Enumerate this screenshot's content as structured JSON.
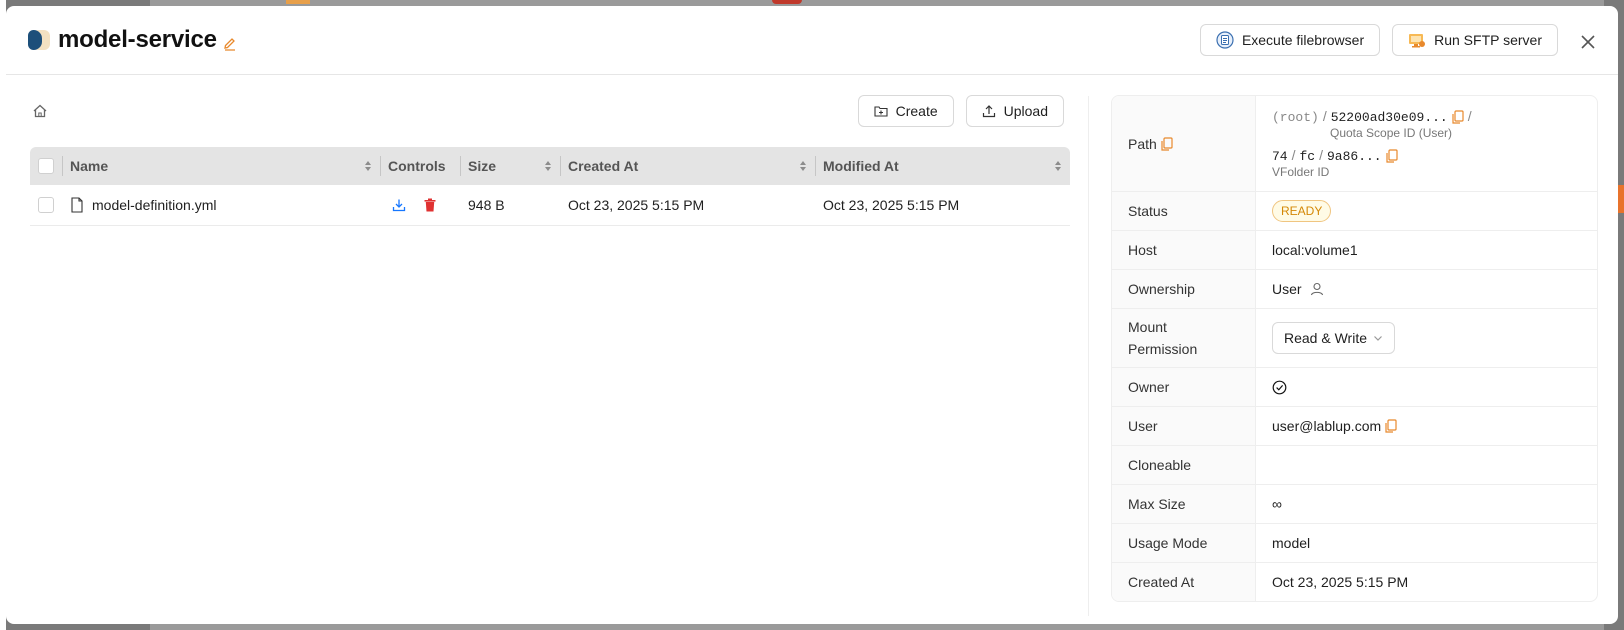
{
  "folder": {
    "title": "model-service"
  },
  "header": {
    "execute_filebrowser": "Execute filebrowser",
    "run_sftp": "Run SFTP server"
  },
  "toolbar": {
    "create": "Create",
    "upload": "Upload"
  },
  "table": {
    "columns": [
      "Name",
      "Controls",
      "Size",
      "Created At",
      "Modified At"
    ],
    "rows": [
      {
        "name": "model-definition.yml",
        "size": "948 B",
        "created": "Oct 23, 2025 5:15 PM",
        "modified": "Oct 23, 2025 5:15 PM"
      }
    ]
  },
  "details": {
    "path_label": "Path",
    "path_root": "(root)",
    "path_quota": "52200ad30e09...",
    "path_quota_caption": "Quota Scope ID (User)",
    "path_seg1": "74",
    "path_seg2": "fc",
    "path_seg3": "9a86...",
    "path_vfolder_caption": "VFolder ID",
    "status_label": "Status",
    "status": "READY",
    "host_label": "Host",
    "host": "local:volume1",
    "ownership_label": "Ownership",
    "ownership": "User",
    "mount_label": "Mount Permission",
    "mount": "Read & Write",
    "owner_label": "Owner",
    "user_label": "User",
    "user": "user@lablup.com",
    "cloneable_label": "Cloneable",
    "maxsize_label": "Max Size",
    "maxsize": "∞",
    "usage_label": "Usage Mode",
    "usage": "model",
    "created_label": "Created At",
    "created": "Oct 23, 2025 5:15 PM"
  },
  "colors": {
    "accent_orange": "#e8892c",
    "download_blue": "#1677ff",
    "delete_red": "#e03131"
  },
  "icons": [
    "folder-logo-icon",
    "edit-icon",
    "filebrowser-icon",
    "sftp-icon",
    "close-icon",
    "home-icon",
    "folder-add-icon",
    "upload-icon",
    "file-icon",
    "download-icon",
    "delete-icon",
    "copy-icon",
    "user-icon",
    "check-circle-icon",
    "chevron-down-icon",
    "sort-icon"
  ]
}
